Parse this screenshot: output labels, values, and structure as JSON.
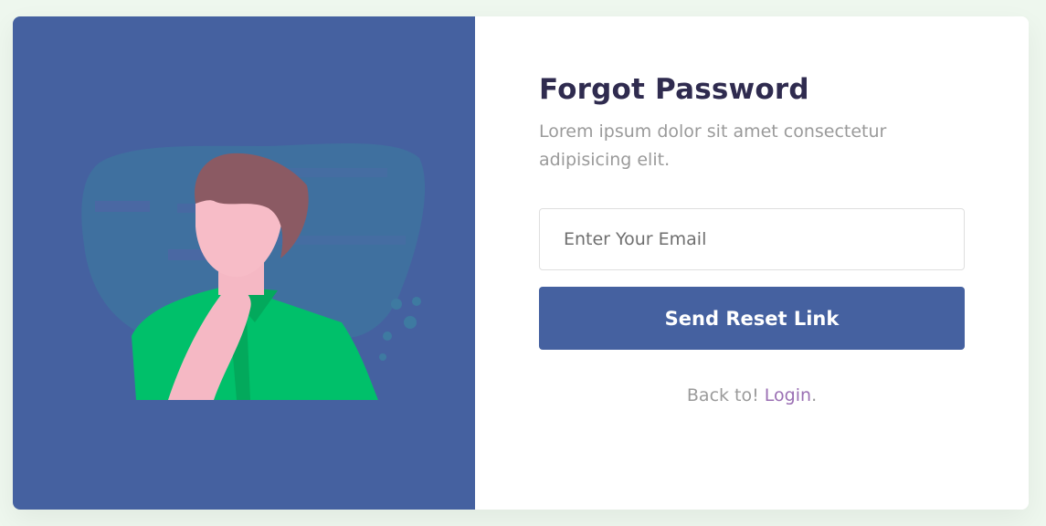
{
  "illustration": {
    "name": "thinking-person-illustration",
    "colors": {
      "panel": "#4561a0",
      "blob": "#3f719f",
      "hair": "#8b5a63",
      "skin": "#f5b8c4",
      "shirt": "#00c06a",
      "shirt_shadow": "#03a95c",
      "dots": "#3e7aa1"
    }
  },
  "form": {
    "title": "Forgot Password",
    "subtitle": "Lorem ipsum dolor sit amet consectetur adipisicing elit.",
    "email_placeholder": "Enter Your Email",
    "email_value": "",
    "submit_label": "Send Reset Link",
    "back_prefix": "Back to! ",
    "login_label": "Login",
    "back_suffix": "."
  },
  "colors": {
    "background": "#eef7ee",
    "primary": "#4561a0",
    "title": "#2f2b4f",
    "muted": "#9a9a9a",
    "link": "#9a6fb3"
  }
}
